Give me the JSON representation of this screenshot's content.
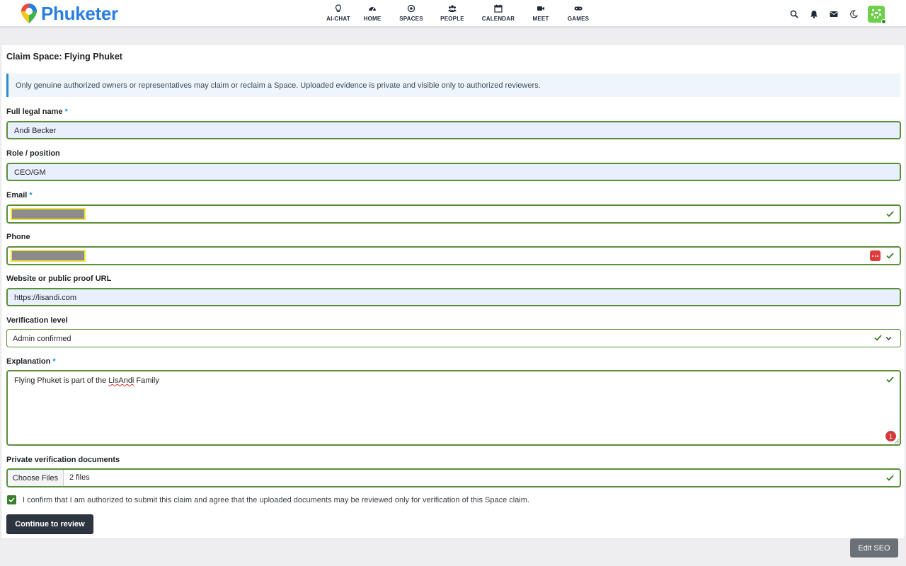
{
  "brand": {
    "name": "Phuketer",
    "accent": "#2a7de1"
  },
  "nav": {
    "items": [
      {
        "label": "AI-CHAT",
        "icon": "bulb-icon"
      },
      {
        "label": "HOME",
        "icon": "dashboard-icon"
      },
      {
        "label": "SPACES",
        "icon": "target-icon"
      },
      {
        "label": "PEOPLE",
        "icon": "people-icon"
      },
      {
        "label": "CALENDAR",
        "icon": "calendar-icon"
      },
      {
        "label": "MEET",
        "icon": "video-icon"
      },
      {
        "label": "GAMES",
        "icon": "gamepad-icon"
      }
    ]
  },
  "header_icons": [
    "search-icon",
    "bell-icon",
    "envelope-icon",
    "moon-icon",
    "avatar"
  ],
  "page": {
    "title": "Claim Space: Flying Phuket",
    "notice": "Only genuine authorized owners or representatives may claim or reclaim a Space. Uploaded evidence is private and visible only to authorized reviewers."
  },
  "form": {
    "required_mark": "*",
    "full_name": {
      "label": "Full legal name",
      "value": "Andi Becker",
      "required": true
    },
    "role": {
      "label": "Role / position",
      "value": "CEO/GM",
      "required": false
    },
    "email": {
      "label": "Email",
      "value": "",
      "required": true,
      "redacted": true
    },
    "phone": {
      "label": "Phone",
      "value": "",
      "required": false,
      "redacted": true
    },
    "website": {
      "label": "Website or public proof URL",
      "value": "https://lisandi.com"
    },
    "verification": {
      "label": "Verification level",
      "selected": "Admin confirmed"
    },
    "explanation": {
      "label": "Explanation",
      "required": true,
      "before": "Flying Phuket is part of the ",
      "spell": "LisAndi",
      "after": " Family",
      "badge": "1"
    },
    "documents": {
      "label": "Private verification documents",
      "button": "Choose Files",
      "status": "2 files"
    },
    "confirm": {
      "checked": true,
      "text": "I confirm that I am authorized to submit this claim and agree that the uploaded documents may be reviewed only for verification of this Space claim."
    },
    "submit_label": "Continue to review"
  },
  "footer": {
    "edit_seo_label": "Edit SEO"
  },
  "colors": {
    "valid_border": "#5a8f3a",
    "notice_border": "#2b8ad6",
    "primary_button": "#2d3540",
    "error_badge": "#d33a3a"
  }
}
